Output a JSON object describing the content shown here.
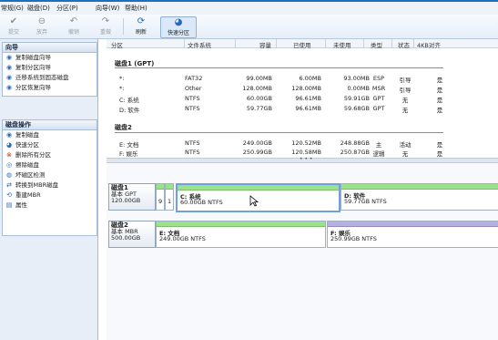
{
  "menu": [
    "常规(G)",
    "磁盘(D)",
    "分区(P)",
    "向导(W)",
    "帮助(H)"
  ],
  "toolbar": [
    {
      "label": "提交",
      "icon": "check-icon",
      "enabled": false
    },
    {
      "label": "放弃",
      "icon": "discard-icon",
      "enabled": false
    },
    {
      "label": "撤销",
      "icon": "undo-icon",
      "enabled": false
    },
    {
      "label": "重做",
      "icon": "redo-icon",
      "enabled": false
    },
    {
      "label": "刷新",
      "icon": "refresh-icon",
      "enabled": true
    },
    {
      "label": "快速分区",
      "icon": "quick-partition-icon",
      "enabled": true,
      "selected": true
    }
  ],
  "wizard_panel": {
    "title": "向导",
    "items": [
      "复制磁盘向导",
      "复制分区向导",
      "迁移系统到固态磁盘",
      "分区恢复向导"
    ]
  },
  "disk_ops_panel": {
    "title": "磁盘操作",
    "items": [
      "复制磁盘",
      "快速分区",
      "删除所有分区",
      "擦除磁盘",
      "坏磁区检测",
      "转换到MBR磁盘",
      "重建MBR",
      "属性"
    ]
  },
  "columns": [
    "分区",
    "文件系统",
    "容量",
    "已使用",
    "未使用",
    "类型",
    "状态",
    "4KB对齐"
  ],
  "disks": [
    {
      "header": "磁盘1 (GPT)",
      "rows": [
        [
          "*:",
          "FAT32",
          "99.00MB",
          "6.00MB",
          "93.00MB",
          "ESP",
          "引导",
          "是"
        ],
        [
          "*:",
          "Other",
          "128.00MB",
          "128.00MB",
          "0.00MB",
          "MSR",
          "引导",
          "是"
        ],
        [
          "C: 系统",
          "NTFS",
          "60.00GB",
          "96.61MB",
          "59.91GB",
          "GPT",
          "无",
          "是"
        ],
        [
          "D: 软件",
          "NTFS",
          "59.77GB",
          "96.61MB",
          "59.68GB",
          "GPT",
          "无",
          "是"
        ]
      ]
    },
    {
      "header": "磁盘2",
      "rows": [
        [
          "E: 文档",
          "NTFS",
          "249.00GB",
          "120.52MB",
          "248.88GB",
          "主",
          "活动",
          "是"
        ],
        [
          "F: 娱乐",
          "NTFS",
          "250.99GB",
          "120.58MB",
          "250.87GB",
          "逻辑",
          "无",
          "是"
        ]
      ]
    }
  ],
  "splitter_mark": "• • •",
  "map": {
    "disk1": {
      "name": "磁盘1",
      "scheme": "基本 GPT",
      "size": "120.00GB",
      "small_parts": [
        "9",
        "1"
      ],
      "parts": [
        {
          "name": "C: 系统",
          "detail": "60.00GB NTFS"
        },
        {
          "name": "D: 软件",
          "detail": "59.77GB NTFS"
        }
      ]
    },
    "disk2": {
      "name": "磁盘2",
      "scheme": "基本 MBR",
      "size": "500.00GB",
      "parts": [
        {
          "name": "E: 文档",
          "detail": "249.00GB NTFS"
        },
        {
          "name": "F: 娱乐",
          "detail": "250.99GB NTFS"
        }
      ]
    }
  },
  "colors": {
    "used_bar": "#9be38a",
    "logical_bar": "#b7b0e0",
    "accent": "#2868b8"
  }
}
